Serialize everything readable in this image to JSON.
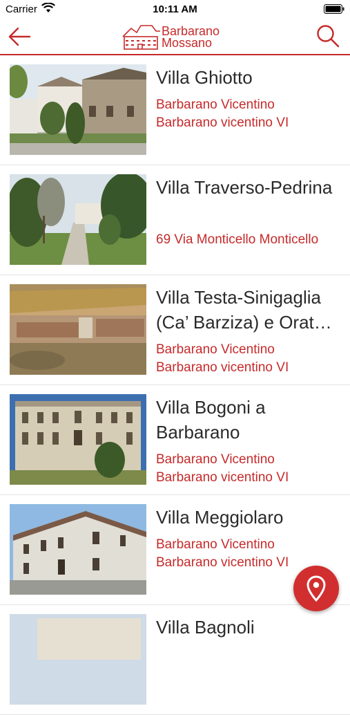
{
  "status_bar": {
    "carrier": "Carrier",
    "time": "10:11 AM",
    "wifi_icon": "wifi-icon",
    "battery_icon": "battery-icon"
  },
  "header": {
    "back_icon": "arrow-left-icon",
    "search_icon": "search-icon",
    "logo_line1": "Barbarano",
    "logo_line2": "Mossano",
    "accent_color": "#c62a2a"
  },
  "villas": [
    {
      "title": "Villa Ghiotto",
      "line1": "Barbarano Vicentino",
      "line2": "Barbarano vicentino VI"
    },
    {
      "title": "Villa Traverso-Pedrina",
      "line1": "69 Via Monticello Monticello",
      "line2": ""
    },
    {
      "title": "Villa Testa-Sinigaglia (Ca’ Barziza) e Orat…",
      "line1": "Barbarano Vicentino",
      "line2": "Barbarano vicentino VI"
    },
    {
      "title": "Villa Bogoni a Barbarano",
      "line1": "Barbarano Vicentino",
      "line2": "Barbarano vicentino VI"
    },
    {
      "title": "Villa Meggiolaro",
      "line1": "Barbarano Vicentino",
      "line2": "Barbarano vicentino VI"
    },
    {
      "title": "Villa Bagnoli",
      "line1": "",
      "line2": ""
    }
  ],
  "map_button_icon": "map-pin-icon"
}
